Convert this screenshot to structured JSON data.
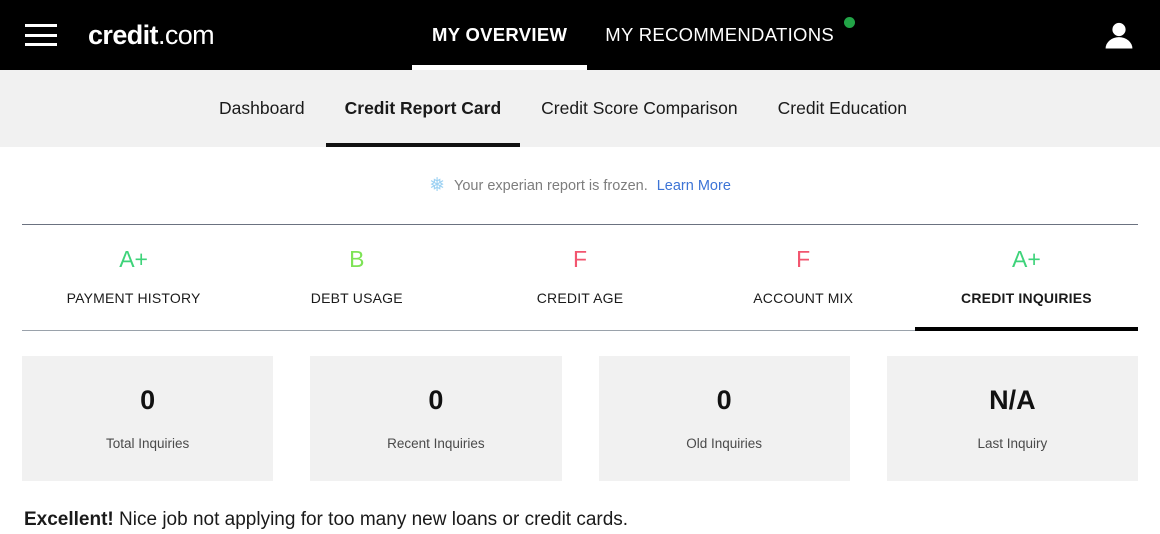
{
  "header": {
    "menu_icon": "hamburger-icon",
    "brand_strong": "credit",
    "brand_light": ".com",
    "nav": [
      {
        "label": "MY OVERVIEW",
        "active": true,
        "badge": false
      },
      {
        "label": "MY RECOMMENDATIONS",
        "active": false,
        "badge": true
      }
    ],
    "badge_color": "#22a447",
    "avatar_icon": "user-avatar-icon"
  },
  "subnav": {
    "items": [
      {
        "label": "Dashboard",
        "active": false
      },
      {
        "label": "Credit Report Card",
        "active": true
      },
      {
        "label": "Credit Score Comparison",
        "active": false
      },
      {
        "label": "Credit Education",
        "active": false
      }
    ]
  },
  "notice": {
    "icon": "snowflake-icon",
    "glyph": "❅",
    "text": "Your experian report is frozen.",
    "link": "Learn More",
    "link_color": "#3d74d6"
  },
  "grades": {
    "items": [
      {
        "letter": "A+",
        "label": "PAYMENT HISTORY",
        "color": "#3ed37a",
        "active": false
      },
      {
        "letter": "B",
        "label": "DEBT USAGE",
        "color": "#7ee356",
        "active": false
      },
      {
        "letter": "F",
        "label": "CREDIT AGE",
        "color": "#f2556f",
        "active": false
      },
      {
        "letter": "F",
        "label": "ACCOUNT MIX",
        "color": "#f2556f",
        "active": false
      },
      {
        "letter": "A+",
        "label": "CREDIT INQUIRIES",
        "color": "#3ed37a",
        "active": true
      }
    ]
  },
  "cards": [
    {
      "value": "0",
      "label": "Total Inquiries"
    },
    {
      "value": "0",
      "label": "Recent Inquiries"
    },
    {
      "value": "0",
      "label": "Old Inquiries"
    },
    {
      "value": "N/A",
      "label": "Last Inquiry"
    }
  ],
  "summary": {
    "headline": "Excellent!",
    "text": " Nice job not applying for too many new loans or credit cards."
  }
}
